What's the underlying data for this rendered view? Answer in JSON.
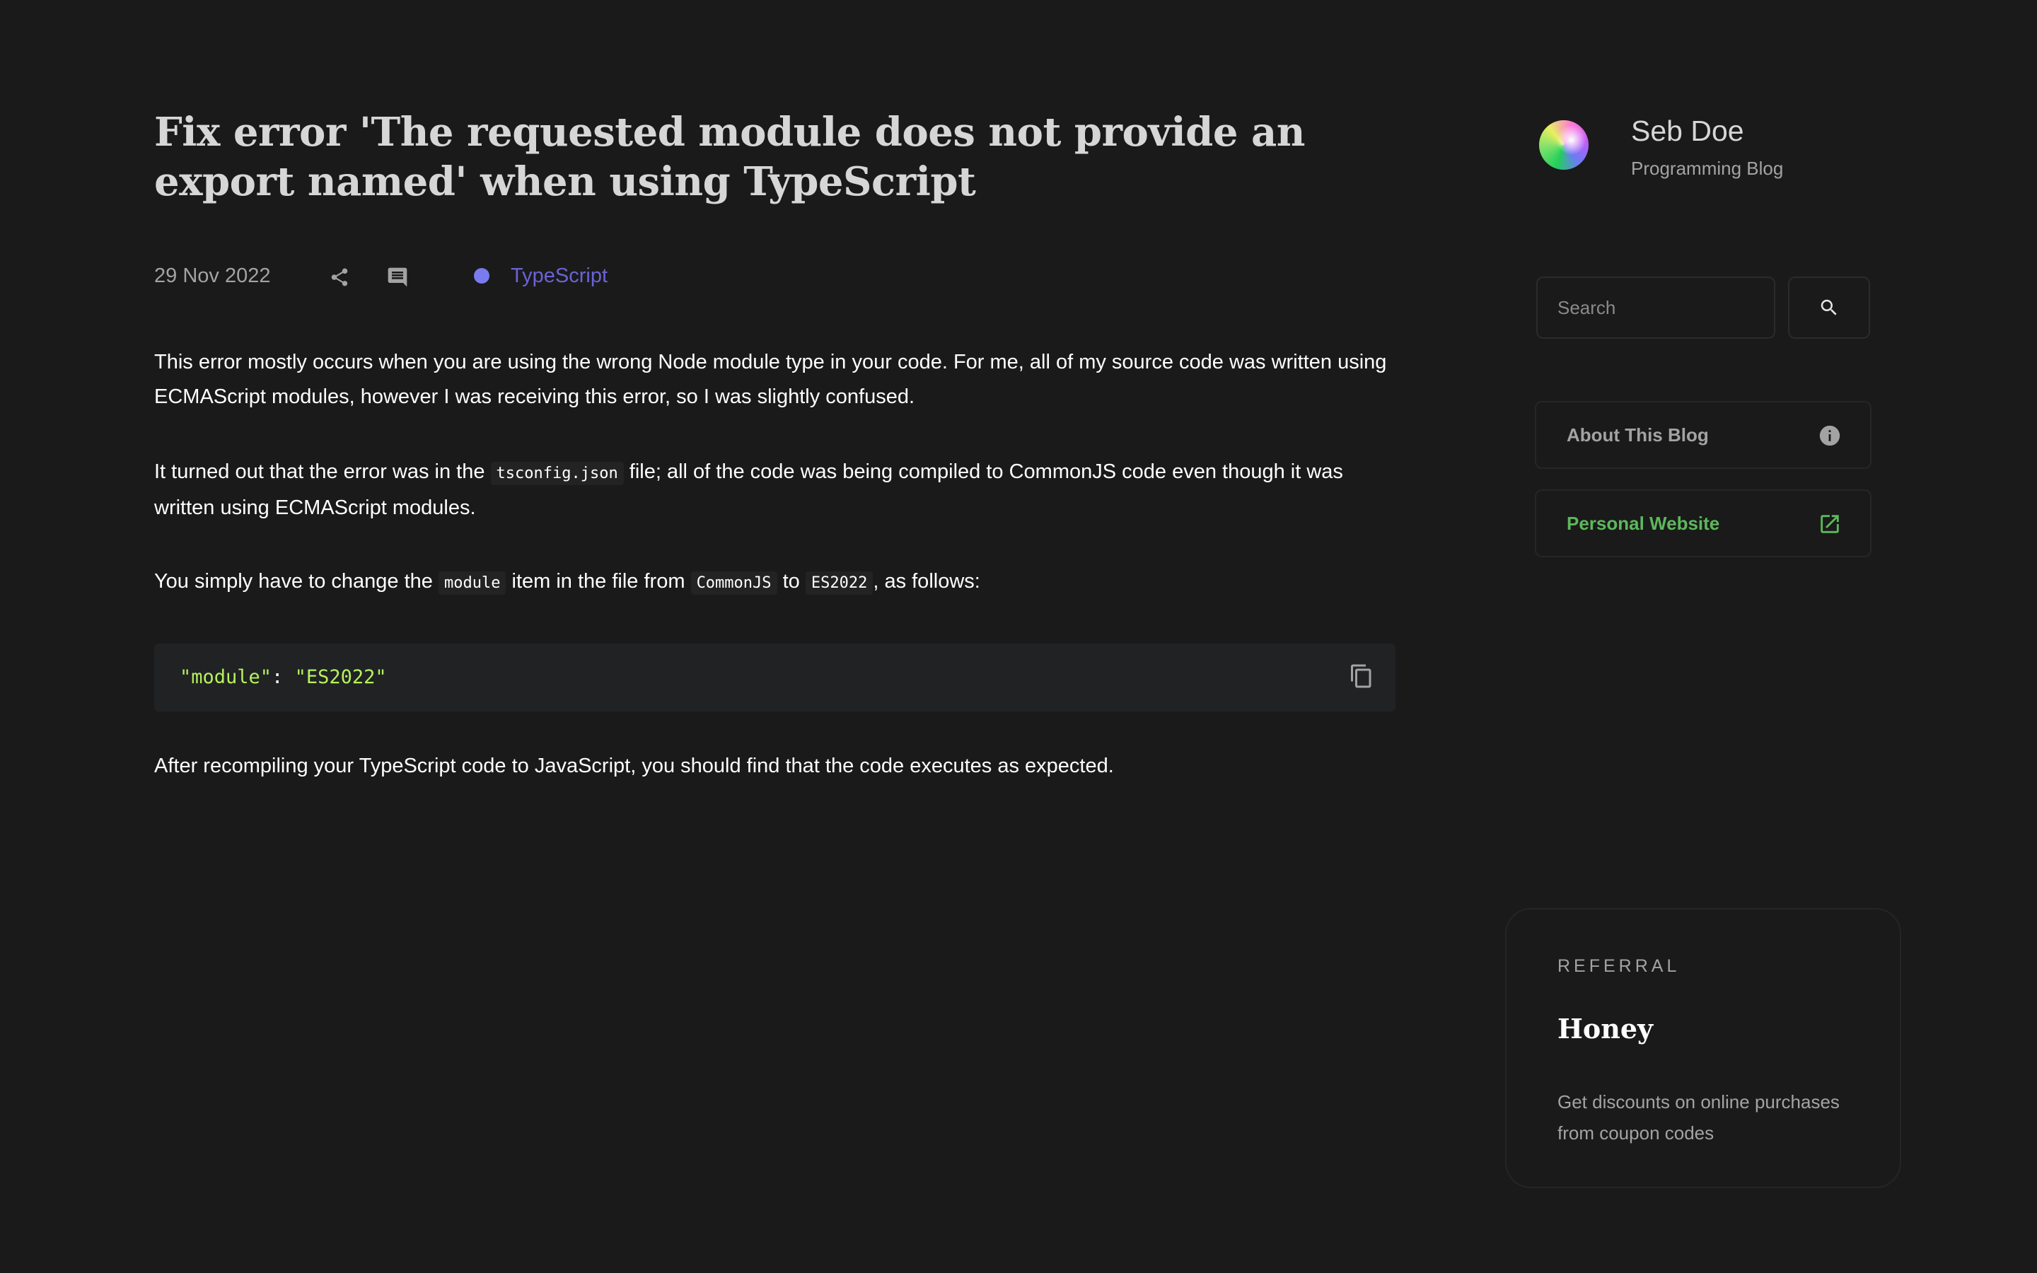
{
  "article": {
    "title": "Fix error 'The requested module does not provide an export named' when using TypeScript",
    "date": "29 Nov 2022",
    "tag": "TypeScript",
    "paragraphs": {
      "p1": "This error mostly occurs when you are using the wrong Node module type in your code. For me, all of my source code was written using ECMAScript modules, however I was receiving this error, so I was slightly confused.",
      "p2_before": "It turned out that the error was in the ",
      "p2_code": "tsconfig.json",
      "p2_after": " file; all of the code was being compiled to CommonJS code even though it was written using ECMAScript modules.",
      "p3_before": "You simply have to change the ",
      "p3_code1": "module",
      "p3_mid1": " item in the file from ",
      "p3_code2": "CommonJS",
      "p3_mid2": " to ",
      "p3_code3": "ES2022",
      "p3_after": ", as follows:",
      "p4": "After recompiling your TypeScript code to JavaScript, you should find that the code executes as expected."
    },
    "code_block": {
      "key": "\"module\"",
      "separator": ": ",
      "value": "\"ES2022\""
    }
  },
  "sidebar": {
    "profile": {
      "name": "Seb Doe",
      "subtitle": "Programming Blog"
    },
    "search": {
      "placeholder": "Search"
    },
    "links": {
      "about": "About This Blog",
      "website": "Personal Website"
    },
    "referral": {
      "eyebrow": "REFERRAL",
      "title": "Honey",
      "description": "Get discounts on online purchases from coupon codes"
    }
  },
  "colors": {
    "background": "#1a1a1a",
    "tag_dot": "#7b7bf0",
    "tag_text": "#6b63d6",
    "website_link": "#5cb85c",
    "code_string": "#b5f25c"
  },
  "icons": {
    "share": "share-icon",
    "comment": "comment-icon",
    "search": "search-icon",
    "info": "info-icon",
    "external_link": "external-link-icon",
    "copy": "copy-icon"
  }
}
